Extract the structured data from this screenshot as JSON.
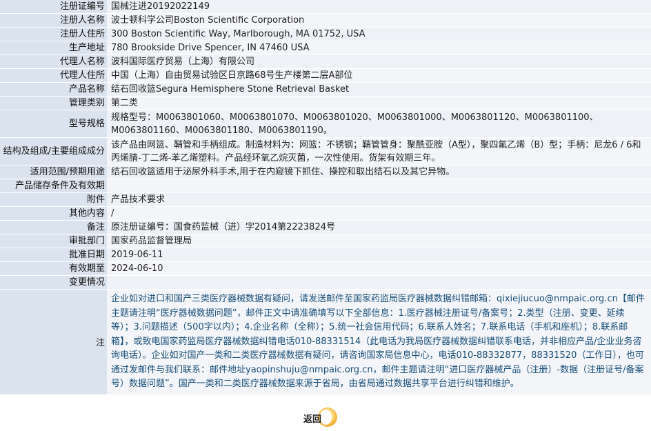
{
  "record": {
    "reg_no_label": "注册证编号",
    "reg_no": "国械注进20192022149",
    "registrant_label": "注册人名称",
    "registrant": "波士顿科学公司Boston Scientific Corporation",
    "registrant_addr_label": "注册人住所",
    "registrant_addr": "300 Boston Scientific Way, Marlborough, MA 01752, USA",
    "production_addr_label": "生产地址",
    "production_addr": "780 Brookside Drive Spencer, IN 47460 USA",
    "agent_label": "代理人名称",
    "agent": "波科国际医疗贸易（上海）有限公司",
    "agent_addr_label": "代理人住所",
    "agent_addr": "中国（上海）自由贸易试验区日京路68号生产楼第二层A部位",
    "product_label": "产品名称",
    "product": "结石回收篮Segura Hemisphere Stone Retrieval Basket",
    "category_label": "管理类别",
    "category": "第二类",
    "model_label": "型号规格",
    "model": "规格型号：M0063801060、M0063801070、M0063801020、M0063801000、M0063801120、M0063801100、M0063801160、M0063801180、M0063801190。",
    "structure_label": "结构及组成/主要组成成分",
    "structure": "该产品由网篮、鞘管和手柄组成。制造材料为：网篮：不锈钢；鞘管管身：聚酰亚胺（A型），聚四氟乙烯（B）型；手柄：尼龙6 / 6和丙烯腈-丁二烯-苯乙烯塑料。产品经环氧乙烷灭菌，一次性使用。货架有效期三年。",
    "scope_label": "适用范围/预期用途",
    "scope": "结石回收篮适用于泌尿外科手术,用于在内窥镜下抓住、操控和取出结石以及其它异物。",
    "storage_label": "产品储存条件及有效期",
    "storage": "",
    "attachment_label": "附件",
    "attachment": "产品技术要求",
    "other_label": "其他内容",
    "other": "/",
    "remark_label": "备注",
    "remark": "原注册证编号：国食药监械（进）字2014第2223824号",
    "approval_dept_label": "审批部门",
    "approval_dept": "国家药品监督管理局",
    "approval_date_label": "批准日期",
    "approval_date": "2019-06-11",
    "valid_until_label": "有效期至",
    "valid_until": "2024-06-10",
    "change_label": "变更情况",
    "change": ""
  },
  "note": {
    "label": "注",
    "text": "企业如对进口和国产三类医疗器械数据有疑问，请发送邮件至国家药监局医疗器械数据纠错邮箱：qixiejiucuo@nmpaic.org.cn【邮件主题请注明“医疗器械数据问题”，邮件正文中请准确填写以下全部信息：1.医疗器械注册证号/备案号；2.类型（注册、变更、延续等）；3.问题描述（500字以内）；4.企业名称（全称）；5.统一社会信用代码；6.联系人姓名；7.联系电话（手机和座机）；8.联系邮箱】，或致电国家药监局医疗器械数据纠错电话010-88331514（此电话为我局医疗器械数据纠错联系电话，并非相应产品/企业业务咨询电话）。企业如对国产一类和二类医疗器械数据有疑问，请咨询国家局信息中心，电话010-88332877，88331520（工作日），也可通过发邮件与我们联系：邮件地址yaopinshuju@nmpaic.org.cn，邮件主题请注明“进口医疗器械产品（注册）-数据（注册证号/备案号）数据问题”。国产一类和二类医疗器械数据来源于省局，由省局通过数据共享平台进行纠错和维护。"
  },
  "back_button": {
    "label": "返回",
    "icon": "back-circle-icon"
  },
  "colors": {
    "label_bg": "#dbe3ee",
    "value_bg": "#eef1f6",
    "note_text": "#1a4f78",
    "button_accent": "#f0a020"
  }
}
